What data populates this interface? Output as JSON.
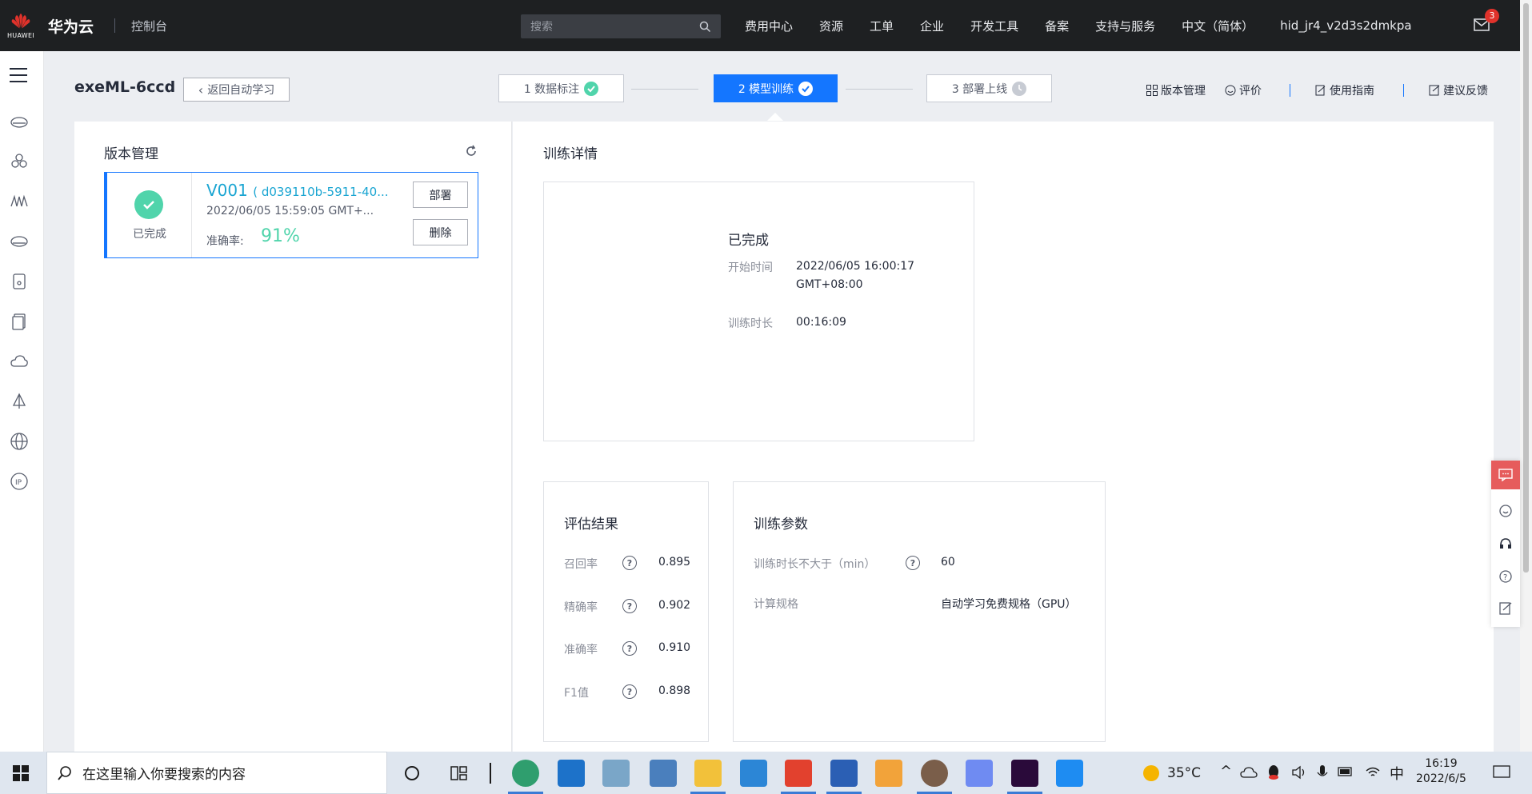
{
  "topbar": {
    "logo_text": "HUAWEI",
    "brand": "华为云",
    "console": "控制台",
    "search_placeholder": "搜索",
    "nav": [
      "费用中心",
      "资源",
      "工单",
      "企业",
      "开发工具",
      "备案",
      "支持与服务",
      "中文（简体）",
      "hid_jr4_v2d3s2dmkpa"
    ],
    "mail_badge": "3"
  },
  "header": {
    "title": "exeML-6ccd",
    "back_label": "返回自动学习",
    "steps": [
      {
        "label": "1 数据标注",
        "state": "done"
      },
      {
        "label": "2 模型训练",
        "state": "active"
      },
      {
        "label": "3 部署上线",
        "state": "pending"
      }
    ],
    "tools": [
      "版本管理",
      "评价",
      "使用指南",
      "建议反馈"
    ]
  },
  "version_panel": {
    "title": "版本管理",
    "card": {
      "status": "已完成",
      "name": "V001",
      "id": "( d039110b-5911-40...",
      "time": "2022/06/05 15:59:05 GMT+...",
      "accuracy_label": "准确率:",
      "accuracy_value": "91%",
      "deploy_label": "部署",
      "delete_label": "删除"
    }
  },
  "detail": {
    "title": "训练详情",
    "status": "已完成",
    "start_label": "开始时间",
    "start_value_line1": "2022/06/05 16:00:17",
    "start_value_line2": "GMT+08:00",
    "duration_label": "训练时长",
    "duration_value": "00:16:09"
  },
  "evaluation": {
    "title": "评估结果",
    "metrics": [
      {
        "label": "召回率",
        "value": "0.895"
      },
      {
        "label": "精确率",
        "value": "0.902"
      },
      {
        "label": "准确率",
        "value": "0.910"
      },
      {
        "label": "F1值",
        "value": "0.898"
      }
    ]
  },
  "params": {
    "title": "训练参数",
    "max_time_label": "训练时长不大于（min）",
    "max_time_value": "60",
    "spec_label": "计算规格",
    "spec_value": "自动学习免费规格（GPU）"
  },
  "taskbar": {
    "search_placeholder": "在这里输入你要搜索的内容",
    "temperature": "35°C",
    "time": "16:19",
    "date": "2022/6/5"
  },
  "colors": {
    "topbar": "#1e2022",
    "accent": "#1476ff",
    "success": "#50d4ab",
    "link": "#1aa5d2",
    "huawei_red": "#e0322b"
  }
}
